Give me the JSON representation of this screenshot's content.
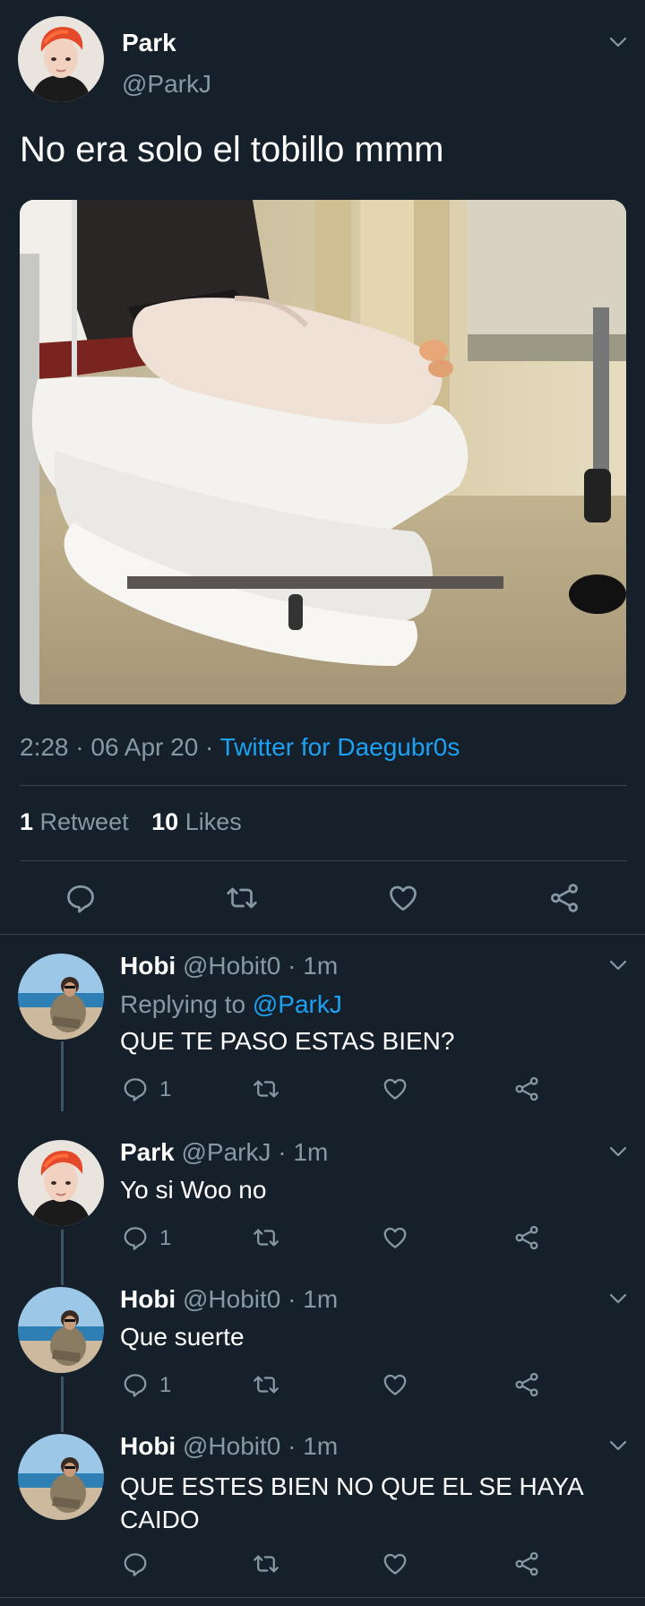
{
  "main_tweet": {
    "author_name": "Park",
    "author_handle": "@ParkJ",
    "text": "No era solo el tobillo mmm",
    "time": "2:28",
    "date": "06 Apr 20",
    "source": "Twitter for Daegubr0s",
    "sep": "·",
    "retweet_count": "1",
    "retweet_label": "Retweet",
    "like_count": "10",
    "like_label": "Likes"
  },
  "replies": [
    {
      "author_name": "Hobi",
      "author_handle": "@Hobit0",
      "time": "· 1m",
      "replying_prefix": "Replying to",
      "replying_to": "@ParkJ",
      "text": "QUE TE PASO ESTAS BIEN?",
      "reply_count": "1"
    },
    {
      "author_name": "Park",
      "author_handle": "@ParkJ",
      "time": "· 1m",
      "text": "Yo si Woo no",
      "reply_count": "1"
    },
    {
      "author_name": "Hobi",
      "author_handle": "@Hobit0",
      "time": "· 1m",
      "text": "Que suerte",
      "reply_count": "1"
    },
    {
      "author_name": "Hobi",
      "author_handle": "@Hobit0",
      "time": "· 1m",
      "text_line1": "QUE ESTES BIEN NO QUE EL SE HAYA",
      "text_line2": "CAIDO"
    }
  ],
  "icons": {
    "reply": "reply-icon",
    "retweet": "retweet-icon",
    "like": "heart-icon",
    "share": "share-icon",
    "more": "chevron-down-icon"
  },
  "colors": {
    "background": "#15202b",
    "text": "#ffffff",
    "muted": "#8899a6",
    "link": "#1da1f2",
    "divider": "#38444d"
  }
}
